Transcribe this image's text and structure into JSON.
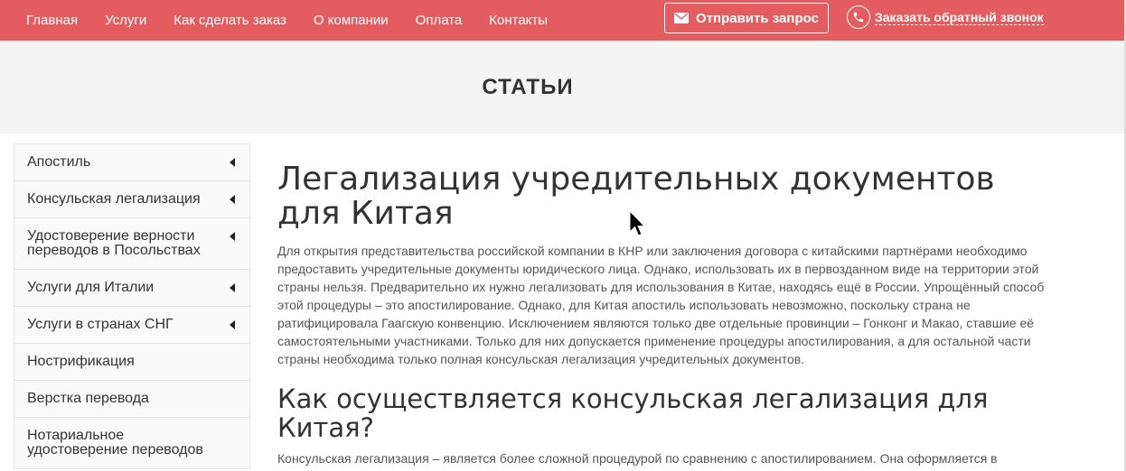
{
  "nav": {
    "items": [
      "Главная",
      "Услуги",
      "Как сделать заказ",
      "О компании",
      "Оплата",
      "Контакты"
    ],
    "request_button": "Отправить запрос",
    "callback_link": "Заказать обратный звонок"
  },
  "colors": {
    "brand": "#e35c5f",
    "hero_bg": "#f4f4f4"
  },
  "icons": {
    "request": "mail-icon",
    "callback": "phone-icon",
    "submenu": "chevron-left-icon"
  },
  "hero": {
    "title": "СТАТЬИ"
  },
  "sidebar": {
    "items": [
      {
        "label": "Апостиль",
        "has_submenu": true
      },
      {
        "label": "Консульская легализация",
        "has_submenu": true
      },
      {
        "label": "Удостоверение верности переводов в Посольствах",
        "has_submenu": true
      },
      {
        "label": "Услуги для Италии",
        "has_submenu": true
      },
      {
        "label": "Услуги в странах СНГ",
        "has_submenu": true
      },
      {
        "label": "Нострификация",
        "has_submenu": false
      },
      {
        "label": "Верстка перевода",
        "has_submenu": false
      },
      {
        "label": "Нотариальное удостоверение переводов",
        "has_submenu": false
      }
    ]
  },
  "article": {
    "title": "Легализация учредительных документов для Китая",
    "paragraph1": "Для открытия представительства российской компании в КНР или заключения договора с китайскими партнёрами необходимо предоставить учредительные документы юридического лица. Однако, использовать их в первозданном виде на территории этой страны нельзя. Предварительно их нужно легализовать для использования в Китае, находясь ещё в России. Упрощённый способ этой процедуры – это апостилирование. Однако, для Китая апостиль использовать невозможно, поскольку страна не ратифицировала Гаагскую конвенцию. Исключением являются только две отдельные провинции – Гонконг и Макао, ставшие её самостоятельными участниками. Только для них допускается применение процедуры апостилирования, а для остальной части страны необходима только полная консульская легализация учредительных документов.",
    "subtitle": "Как осуществляется консульская легализация для Китая?",
    "paragraph2": "Консульская легализация – является более сложной процедурой по сравнению с апостилированием. Она оформляется в несколько этапов с участием государственных учреждений обеих стран:"
  }
}
